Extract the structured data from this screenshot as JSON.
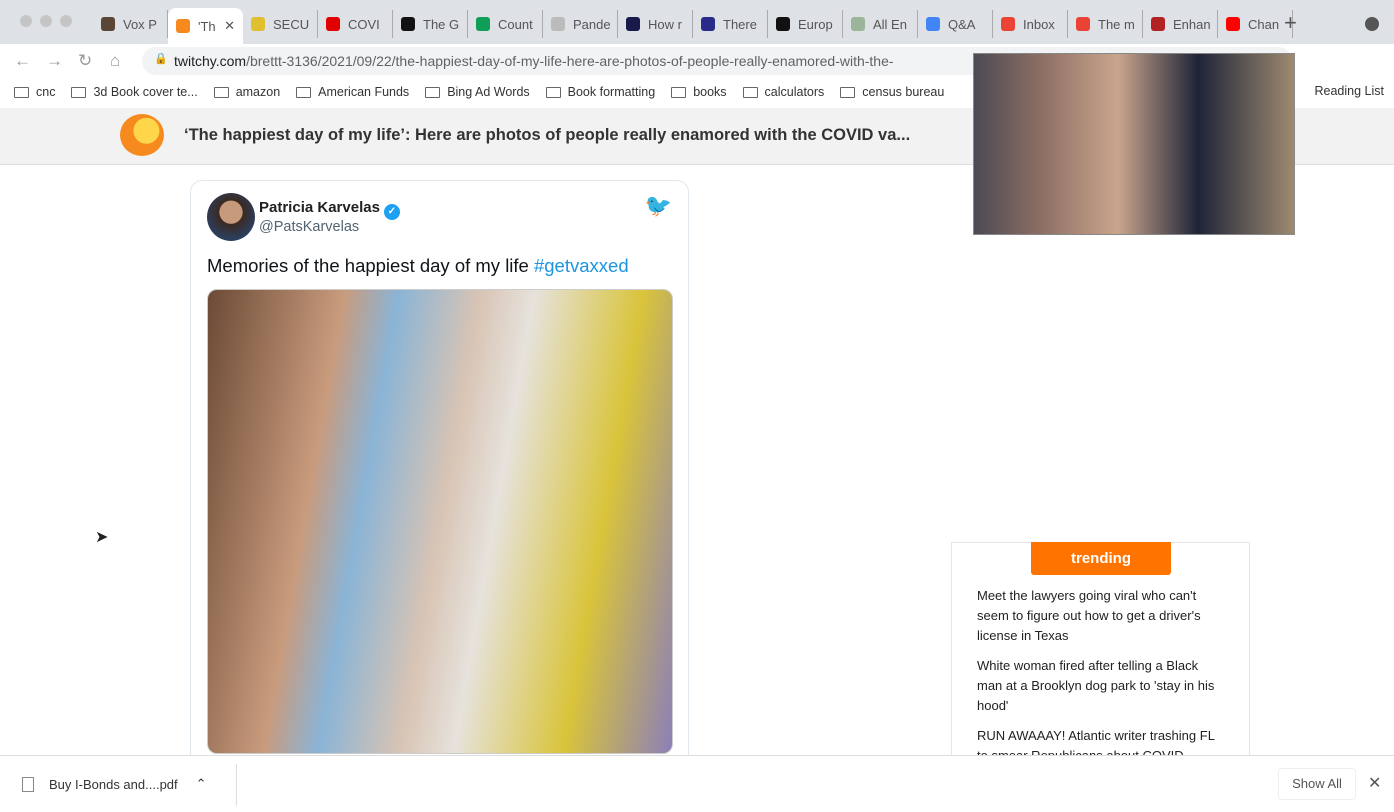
{
  "browser": {
    "tabs": [
      {
        "label": "Vox P",
        "color": "#5b4636"
      },
      {
        "label": "'Th",
        "color": "#f68a1e",
        "active": true
      },
      {
        "label": "SECU",
        "color": "#e0c030"
      },
      {
        "label": "COVI",
        "color": "#e00000"
      },
      {
        "label": "The G",
        "color": "#111111"
      },
      {
        "label": "Count",
        "color": "#0f9d58"
      },
      {
        "label": "Pande",
        "color": "#bbbbbb"
      },
      {
        "label": "How r",
        "color": "#1a1a4a"
      },
      {
        "label": "There",
        "color": "#2a2a8a"
      },
      {
        "label": "Europ",
        "color": "#111111"
      },
      {
        "label": "All En",
        "color": "#9bb59b"
      },
      {
        "label": "Q&A",
        "color": "#4285f4"
      },
      {
        "label": "Inbox",
        "color": "#ea4335"
      },
      {
        "label": "The m",
        "color": "#ea4335"
      },
      {
        "label": "Enhan",
        "color": "#b22222"
      },
      {
        "label": "Chan",
        "color": "#ff0000"
      }
    ],
    "close_tab": "✕",
    "new_tab": "+",
    "url_domain": "twitchy.com",
    "url_path": "/brettt-3136/2021/09/22/the-happiest-day-of-my-life-here-are-photos-of-people-really-enamored-with-the-",
    "bookmarks": [
      "cnc",
      "3d Book cover te...",
      "amazon",
      "American Funds",
      "Bing Ad Words",
      "Book formatting",
      "books",
      "calculators",
      "census bureau"
    ],
    "reading_list": "Reading List"
  },
  "site": {
    "title": "‘The happiest day of my life’: Here are photos of people really enamored with the COVID va..."
  },
  "tweet": {
    "name": "Patricia Karvelas",
    "handle": "@PatsKarvelas",
    "text": "Memories of the happiest day of my life ",
    "hashtag": "#getvaxxed"
  },
  "trending": {
    "label": "trending",
    "items": [
      "Meet the lawyers going viral who can't seem to figure out how to get a driver's license in Texas",
      "White woman fired after telling a Black man at a Brooklyn dog park to 'stay in his hood'",
      "RUN AWAAAY! Atlantic writer trashing FL to smear Republicans about COVID..."
    ]
  },
  "downloads": {
    "file": "Buy I-Bonds and....pdf",
    "show_all": "Show All",
    "close": "✕"
  }
}
